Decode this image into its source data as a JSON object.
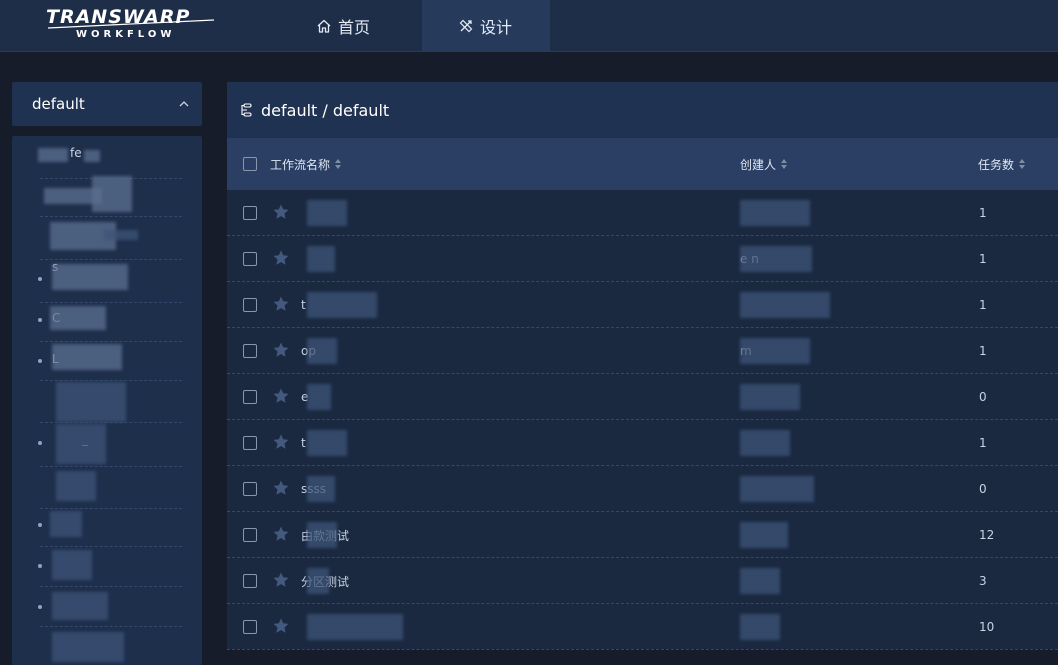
{
  "header": {
    "logo_line1": "TRANSWARP",
    "logo_line2": "WORKFLOW",
    "nav": [
      {
        "label": "首页",
        "icon": "home-icon",
        "active": false
      },
      {
        "label": "设计",
        "icon": "design-tools-icon",
        "active": true
      }
    ]
  },
  "sidebar": {
    "project_select": "default",
    "tree_items": [
      {
        "label": "fe",
        "blurred": true
      },
      {
        "label": "",
        "blurred": true
      },
      {
        "label": "",
        "blurred": true
      },
      {
        "label": "",
        "blurred": true
      },
      {
        "label": "s",
        "blurred": true
      },
      {
        "label": "C",
        "blurred": true
      },
      {
        "label": "L",
        "blurred": true
      },
      {
        "label": "",
        "blurred": true
      },
      {
        "label": "_",
        "blurred": true
      },
      {
        "label": "",
        "blurred": true
      },
      {
        "label": "",
        "blurred": true
      },
      {
        "label": "",
        "blurred": true
      },
      {
        "label": "",
        "blurred": true
      }
    ]
  },
  "main": {
    "breadcrumb": "default / default",
    "columns": [
      "工作流名称",
      "创建人",
      "任务数"
    ],
    "rows": [
      {
        "name": "",
        "creator": "",
        "count": "1"
      },
      {
        "name": "",
        "creator": "e              n",
        "count": "1"
      },
      {
        "name": "t",
        "creator": "",
        "count": "1"
      },
      {
        "name": "op",
        "creator": "m",
        "count": "1"
      },
      {
        "name": "e",
        "creator": "",
        "count": "0"
      },
      {
        "name": "t",
        "creator": "",
        "count": "1"
      },
      {
        "name": "ssss",
        "creator": "",
        "count": "0"
      },
      {
        "name": "由款测试",
        "creator": "",
        "count": "12"
      },
      {
        "name": "分区测试",
        "creator": "",
        "count": "3"
      },
      {
        "name": "",
        "creator": "",
        "count": "10"
      }
    ]
  },
  "colors": {
    "topbar": "#1f2e48",
    "nav_active": "#263b5c",
    "background": "#161c29",
    "panel": "#1a2940",
    "table_header": "#2a3f63"
  }
}
